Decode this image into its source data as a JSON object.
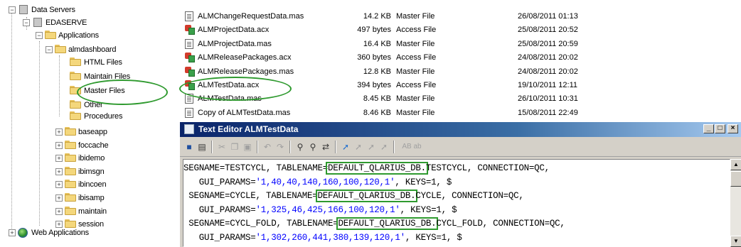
{
  "tree": {
    "data_servers": "Data Servers",
    "server": "EDASERVE",
    "applications": "Applications",
    "almdashboard": "almdashboard",
    "html_files": "HTML Files",
    "maintain_files": "Maintain Files",
    "master_files": "Master Files",
    "other": "Other",
    "procedures": "Procedures",
    "apps": [
      "baseapp",
      "foccache",
      "ibidemo",
      "ibimsgn",
      "ibincoen",
      "ibisamp",
      "maintain",
      "session"
    ],
    "web_applications": "Web Applications",
    "expand_plus": "+",
    "expand_minus": "−"
  },
  "files": [
    {
      "icon": "master-file-icon",
      "name": "ALMChangeRequestData.mas",
      "size": "14.2 KB",
      "type": "Master File",
      "date": "26/08/2011 01:13"
    },
    {
      "icon": "access-file-icon",
      "name": "ALMProjectData.acx",
      "size": "497 bytes",
      "type": "Access File",
      "date": "25/08/2011 20:52"
    },
    {
      "icon": "master-file-icon",
      "name": "ALMProjectData.mas",
      "size": "16.4 KB",
      "type": "Master File",
      "date": "25/08/2011 20:59"
    },
    {
      "icon": "access-file-icon",
      "name": "ALMReleasePackages.acx",
      "size": "360 bytes",
      "type": "Access File",
      "date": "24/08/2011 20:02"
    },
    {
      "icon": "access-file-icon",
      "name": "ALMReleasePackages.mas",
      "size": "12.8 KB",
      "type": "Master File",
      "date": "24/08/2011 20:02"
    },
    {
      "icon": "access-file-icon",
      "name": "ALMTestData.acx",
      "size": "394 bytes",
      "type": "Access File",
      "date": "19/10/2011 12:11"
    },
    {
      "icon": "master-file-icon",
      "name": "ALMTestData.mas",
      "size": "8.45 KB",
      "type": "Master File",
      "date": "26/10/2011 10:31"
    },
    {
      "icon": "master-file-icon",
      "name": "Copy of ALMTestData.mas",
      "size": "8.46 KB",
      "type": "Master File",
      "date": "15/08/2011 22:49"
    }
  ],
  "editor": {
    "title": "Text Editor ALMTestData",
    "minimize": "_",
    "maximize": "□",
    "close": "×",
    "toolbar": [
      "save-icon",
      "print-icon",
      "cut-icon",
      "copy-icon",
      "paste-icon",
      "undo-icon",
      "redo-icon",
      "find-icon",
      "find-next-icon",
      "replace-icon",
      "bookmark-icon",
      "toggle-bookmark-icon",
      "next-bookmark-icon",
      "clear-bookmarks-icon"
    ],
    "toolbar_text": "AB ab",
    "lines": [
      {
        "a": "SEGNAME=TESTCYCL, TABLENAME=",
        "box": "DEFAULT_QLARIUS_DB.",
        "b": "TESTCYCL, CONNECTION=QC,"
      },
      {
        "a": "   GUI_PARAMS=",
        "val": "'1,40,40,140,160,100,120,1'",
        "b": ", KEYS=1, $"
      },
      {
        "a": " SEGNAME=CYCLE, TABLENAME=",
        "box": "DEFAULT_QLARIUS_DB.",
        "b": "CYCLE, CONNECTION=QC,"
      },
      {
        "a": "   GUI_PARAMS=",
        "val": "'1,325,46,425,166,100,120,1'",
        "b": ", KEYS=1, $"
      },
      {
        "a": " SEGNAME=CYCL_FOLD, TABLENAME=",
        "box": "DEFAULT_QLARIUS_DB.",
        "b": "CYCL_FOLD, CONNECTION=QC,"
      },
      {
        "a": "   GUI_PARAMS=",
        "val": "'1,302,260,441,380,139,120,1'",
        "b": ", KEYS=1, $"
      }
    ],
    "scroll_up": "▲",
    "scroll_down": "▼"
  },
  "colors": {
    "highlight": "#2f9a2f",
    "code_value": "#0000ff",
    "titlebar": "#0a246a"
  }
}
